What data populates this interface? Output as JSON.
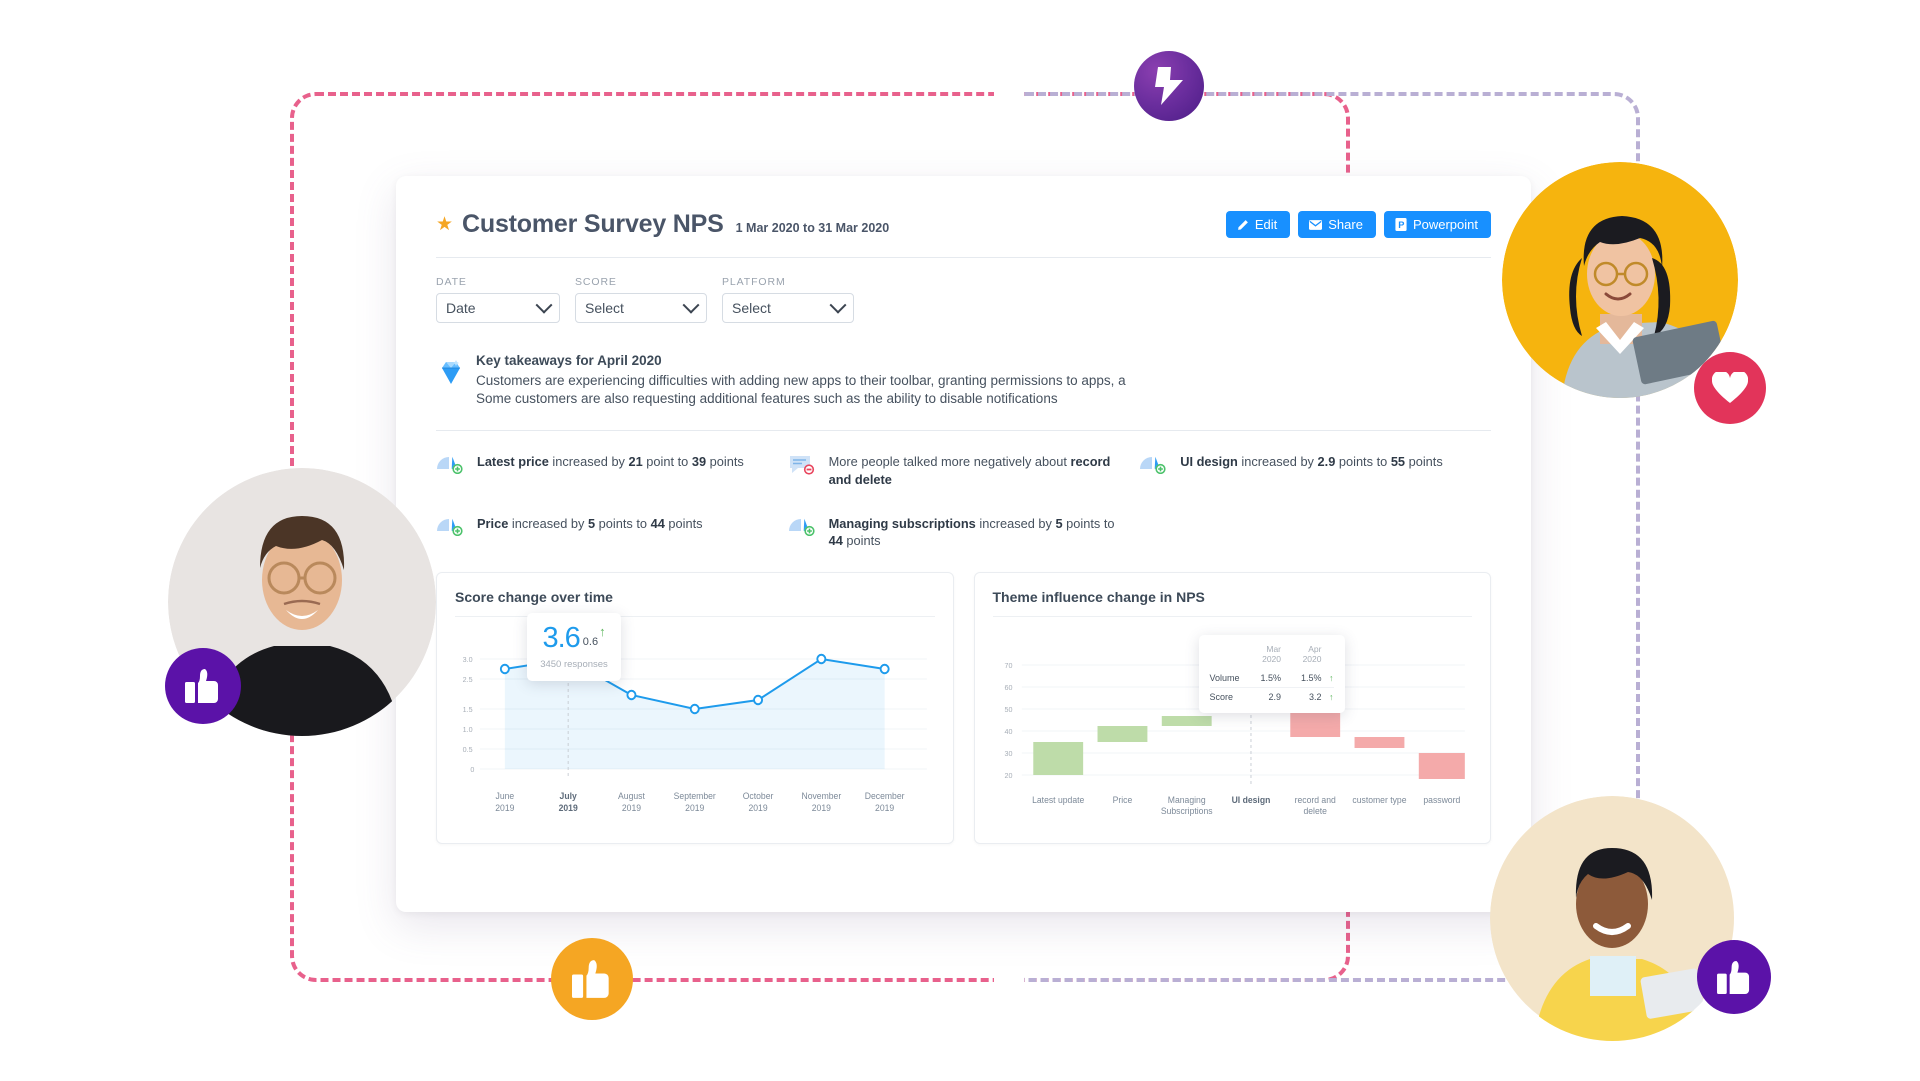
{
  "header": {
    "star_icon": "star-icon",
    "title": "Customer Survey NPS",
    "date_range": "1 Mar 2020 to 31 Mar 2020",
    "actions": [
      {
        "label": "Edit",
        "icon": "pencil-icon"
      },
      {
        "label": "Share",
        "icon": "envelope-icon"
      },
      {
        "label": "Powerpoint",
        "icon": "powerpoint-icon"
      }
    ]
  },
  "filters": [
    {
      "label": "DATE",
      "value": "Date"
    },
    {
      "label": "SCORE",
      "value": "Select"
    },
    {
      "label": "PLATFORM",
      "value": "Select"
    }
  ],
  "takeaways": {
    "icon": "diamond-icon",
    "title": "Key takeaways for April 2020",
    "line1": "Customers are experiencing difficulties with adding new apps to their toolbar, granting permissions to apps, a",
    "line2": "Some customers are also requesting additional features such as the ability to disable notifications"
  },
  "insights": [
    {
      "icon": "gauge-up-icon",
      "bold1": "Latest price",
      "mid": " increased by ",
      "bold2": "21",
      "mid2": " point to ",
      "bold3": "39",
      "tail": " points"
    },
    {
      "icon": "comment-negative-icon",
      "bold1": "",
      "mid": "More people talked more negatively about ",
      "bold2": "record and delete",
      "mid2": "",
      "bold3": "",
      "tail": ""
    },
    {
      "icon": "gauge-up-icon",
      "bold1": "UI design",
      "mid": " increased by ",
      "bold2": "2.9",
      "mid2": " points to ",
      "bold3": "55",
      "tail": " points"
    },
    {
      "icon": "gauge-up-icon",
      "bold1": "Price",
      "mid": " increased by ",
      "bold2": "5",
      "mid2": " points to ",
      "bold3": "44",
      "tail": " points"
    },
    {
      "icon": "gauge-up-icon",
      "bold1": "Managing subscriptions",
      "mid": " increased by ",
      "bold2": "5",
      "mid2": " points to ",
      "bold3": "44",
      "tail": " points"
    }
  ],
  "line_panel": {
    "title": "Score change over time",
    "tooltip": {
      "value": "3.6",
      "delta": "0.6",
      "arrow": "↑",
      "responses": "3450 responses"
    }
  },
  "waterfall_panel": {
    "title": "Theme influence change in NPS",
    "tooltip": {
      "col1": "Mar 2020",
      "col2": "Apr 2020",
      "rows": [
        {
          "label": "Volume",
          "v1": "1.5%",
          "v2": "1.5%",
          "arrow": "↑"
        },
        {
          "label": "Score",
          "v1": "2.9",
          "v2": "3.2",
          "arrow": "↑"
        }
      ]
    }
  },
  "colors": {
    "accent_blue": "#1890FF",
    "line_blue": "#1E9BEC",
    "positive_green": "#B7DDA4",
    "highlight_green": "#57B857",
    "negative_red": "#F4AAAA",
    "star_orange": "#F5A623",
    "dash_pink": "#E8618C",
    "dash_purple": "#B9AFD4"
  },
  "chart_data": [
    {
      "type": "line",
      "title": "Score change over time",
      "xlabel": "",
      "ylabel": "",
      "ylim": [
        0,
        3.2
      ],
      "yticks": [
        "3.0",
        "2.5",
        "1.5",
        "1.0",
        "0.5",
        "0"
      ],
      "grid": true,
      "categories": [
        "June 2019",
        "July 2019",
        "August 2019",
        "September 2019",
        "October 2019",
        "November 2019",
        "December 2019"
      ],
      "values": [
        2.8,
        3.0,
        2.2,
        1.95,
        2.15,
        3.0,
        2.8
      ],
      "highlighted_category": "July 2019",
      "annotations": [
        "3.6",
        "0.6",
        "3450 responses"
      ]
    },
    {
      "type": "bar",
      "subtype": "waterfall",
      "title": "Theme influence change in NPS",
      "xlabel": "",
      "ylabel": "",
      "ylim": [
        16,
        74
      ],
      "yticks": [
        20,
        30,
        40,
        50,
        60,
        70
      ],
      "grid": true,
      "categories": [
        "Latest update",
        "Price",
        "Managing Subscriptions",
        "UI design",
        "record and delete",
        "customer type",
        "password"
      ],
      "bars": [
        {
          "category": "Latest update",
          "start": 24,
          "end": 38.5,
          "direction": "up"
        },
        {
          "category": "Price",
          "start": 38.5,
          "end": 45.5,
          "direction": "up"
        },
        {
          "category": "Managing Subscriptions",
          "start": 45.5,
          "end": 50,
          "direction": "up"
        },
        {
          "category": "UI design",
          "start": 50,
          "end": 55,
          "direction": "up"
        },
        {
          "category": "record and delete",
          "start": 50.5,
          "end": 37,
          "direction": "down"
        },
        {
          "category": "customer type",
          "start": 37,
          "end": 32,
          "direction": "down"
        },
        {
          "category": "password",
          "start": 30,
          "end": 18.5,
          "direction": "down"
        }
      ],
      "highlighted_category": "UI design",
      "legend_position": "none"
    }
  ]
}
